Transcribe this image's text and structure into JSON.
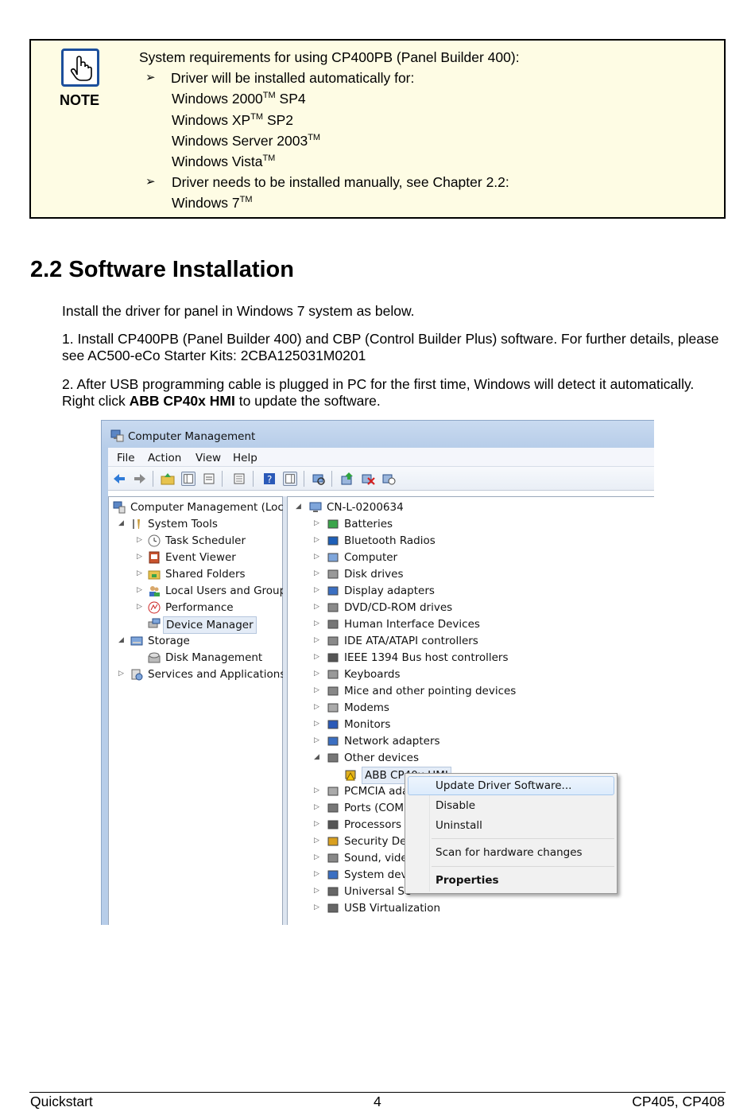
{
  "note": {
    "label": "NOTE",
    "heading": "System requirements for using CP400PB (Panel Builder 400):",
    "auto_title": "Driver will be installed automatically for:",
    "auto_items": [
      {
        "name": "Windows 2000",
        "tm": "TM",
        "suffix": " SP4"
      },
      {
        "name": "Windows XP",
        "tm": "TM",
        "suffix": " SP2"
      },
      {
        "name": "Windows Server 2003",
        "tm": "TM",
        "suffix": ""
      },
      {
        "name": "Windows Vista",
        "tm": "TM",
        "suffix": ""
      }
    ],
    "manual_title": "Driver needs to be installed manually, see Chapter 2.2:",
    "manual_item": {
      "name": "Windows 7",
      "tm": "TM",
      "suffix": ""
    }
  },
  "section": {
    "title": "2.2 Software Installation",
    "intro": "Install the driver for panel in Windows 7 system as below.",
    "step1": "1. Install CP400PB (Panel Builder 400) and CBP (Control Builder Plus) software. For further details, please see AC500-eCo Starter Kits: 2CBA125031M0201",
    "step2_prefix": "2. After USB programming cable is plugged in PC for the first time, Windows will detect it automatically. Right click ",
    "step2_bold": "ABB CP40x HMI",
    "step2_suffix": " to update the software."
  },
  "window": {
    "title": "Computer Management",
    "menu": [
      "File",
      "Action",
      "View",
      "Help"
    ],
    "left_tree": [
      "Computer Management (Local",
      "System Tools",
      "Task Scheduler",
      "Event Viewer",
      "Shared Folders",
      "Local Users and Groups",
      "Performance",
      "Device Manager",
      "Storage",
      "Disk Management",
      "Services and Applications"
    ],
    "root": "CN-L-0200634",
    "devices": [
      "Batteries",
      "Bluetooth Radios",
      "Computer",
      "Disk drives",
      "Display adapters",
      "DVD/CD-ROM drives",
      "Human Interface Devices",
      "IDE ATA/ATAPI controllers",
      "IEEE 1394 Bus host controllers",
      "Keyboards",
      "Mice and other pointing devices",
      "Modems",
      "Monitors",
      "Network adapters",
      "Other devices",
      "ABB CP40x HMI",
      "PCMCIA ada",
      "Ports (COM",
      "Processors",
      "Security Dev",
      "Sound, vide",
      "System devi",
      "Universal Se",
      "USB Virtualization"
    ],
    "context_menu": [
      "Update Driver Software...",
      "Disable",
      "Uninstall",
      "Scan for hardware changes",
      "Properties"
    ]
  },
  "footer": {
    "left": "Quickstart",
    "center": "4",
    "right": "CP405, CP408"
  }
}
